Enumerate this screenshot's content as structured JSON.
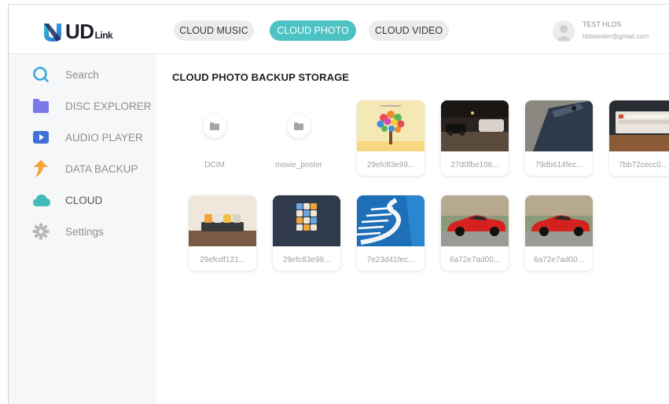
{
  "app": {
    "logo_text": "UD",
    "logo_suffix": "Link"
  },
  "header": {
    "tabs": [
      {
        "label": "CLOUD MUSIC",
        "active": false
      },
      {
        "label": "CLOUD PHOTO",
        "active": true
      },
      {
        "label": "CLOUD VIDEO",
        "active": false
      }
    ],
    "user": {
      "name": "TEST HLDS",
      "email": "hldstester@gmail.com"
    }
  },
  "sidebar": {
    "items": [
      {
        "label": "Search",
        "icon": "search-icon",
        "color": "#3aa8d8"
      },
      {
        "label": "DISC EXPLORER",
        "icon": "folder-icon",
        "color": "#7b79e8"
      },
      {
        "label": "AUDIO PLAYER",
        "icon": "play-icon",
        "color": "#3f6fd8"
      },
      {
        "label": "DATA BACKUP",
        "icon": "upload-arrow-icon",
        "color": "#f3a43a"
      },
      {
        "label": "CLOUD",
        "icon": "cloud-icon",
        "color": "#3fbcb9",
        "active": true
      },
      {
        "label": "Settings",
        "icon": "gear-icon",
        "color": "#b8b8b8"
      }
    ]
  },
  "main": {
    "title": "CLOUD PHOTO BACKUP STORAGE",
    "folders": [
      {
        "label": "DCIM",
        "icon": "folder-icon"
      },
      {
        "label": "movie_poster",
        "icon": "folder-icon"
      }
    ],
    "photos": [
      {
        "label": "29efc83e99...",
        "subject": "heart-balloon-tree"
      },
      {
        "label": "27d0fbe106...",
        "subject": "night-parking-lot"
      },
      {
        "label": "79db614fec...",
        "subject": "phone-closeup"
      },
      {
        "label": "7bb72cecc0...",
        "subject": "keyboard-on-desk"
      },
      {
        "label": "29efcdf121...",
        "subject": "colorful-keycaps-row"
      },
      {
        "label": "29efc83e99...",
        "subject": "keycap-block"
      },
      {
        "label": "7e23d41fec...",
        "subject": "spiral-staircase"
      },
      {
        "label": "6a72e7ad00...",
        "subject": "red-sports-car"
      },
      {
        "label": "6a72e7ad00...",
        "subject": "red-sports-car"
      }
    ]
  },
  "colors": {
    "accent": "#4cc2c4",
    "sidebar_bg": "#f6f7f8"
  }
}
